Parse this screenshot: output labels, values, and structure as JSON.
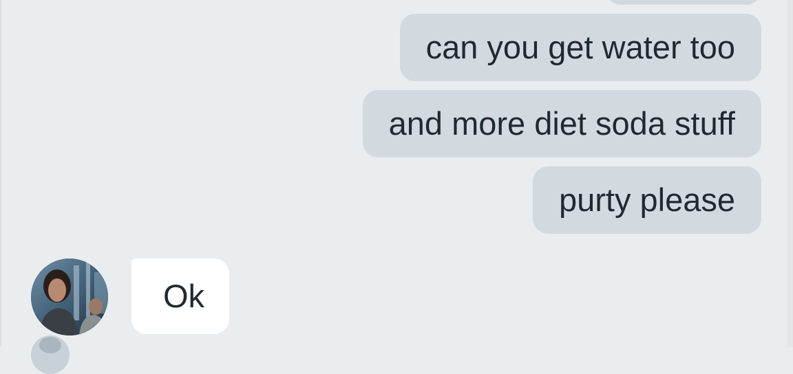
{
  "conversation": {
    "outgoing": [
      {
        "text": "can you get water too"
      },
      {
        "text": "and more diet soda stuff"
      },
      {
        "text": "purty please"
      }
    ],
    "incoming": [
      {
        "text": "Ok",
        "sender_avatar": "contact-photo"
      }
    ]
  },
  "colors": {
    "background": "#e9edf0",
    "outgoing_bubble": "#d3dadf",
    "incoming_bubble": "#ffffff",
    "text": "#1f2a30"
  }
}
